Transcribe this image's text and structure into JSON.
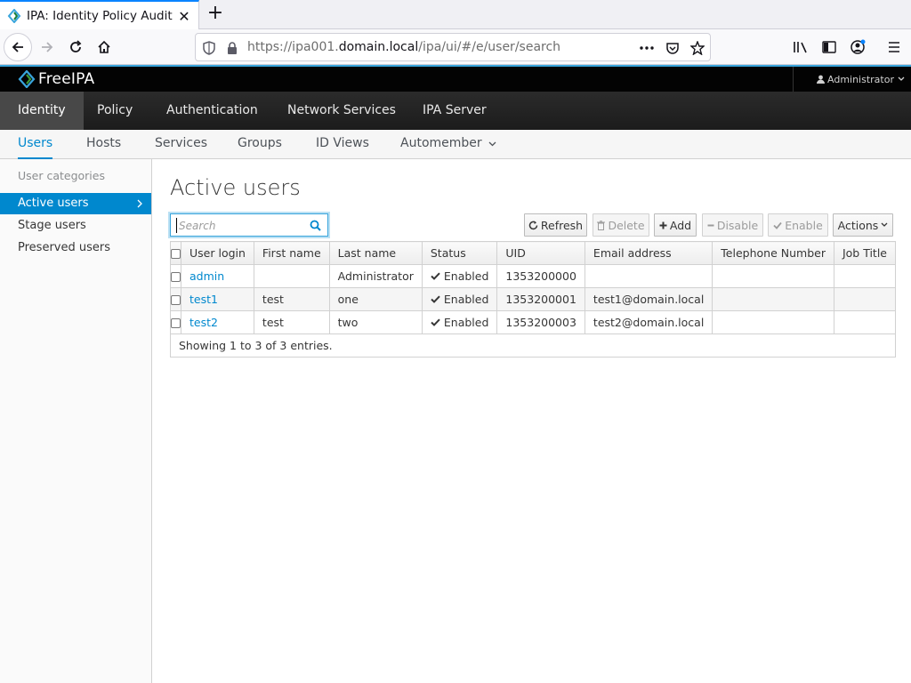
{
  "browser": {
    "tab_title": "IPA: Identity Policy Audit",
    "tab_close": "✕",
    "new_tab": "+",
    "url_prefix": "https://ipa001.",
    "url_host": "domain.local",
    "url_path": "/ipa/ui/#/e/user/search"
  },
  "header": {
    "brand": "FreeIPA",
    "user_menu": "Administrator"
  },
  "primary_nav": [
    {
      "label": "Identity",
      "active": true
    },
    {
      "label": "Policy"
    },
    {
      "label": "Authentication"
    },
    {
      "label": "Network Services"
    },
    {
      "label": "IPA Server"
    }
  ],
  "secondary_nav": [
    {
      "label": "Users",
      "active": true
    },
    {
      "label": "Hosts"
    },
    {
      "label": "Services"
    },
    {
      "label": "Groups"
    },
    {
      "label": "ID Views"
    },
    {
      "label": "Automember"
    }
  ],
  "sidebar": {
    "heading": "User categories",
    "items": [
      {
        "label": "Active users",
        "active": true
      },
      {
        "label": "Stage users"
      },
      {
        "label": "Preserved users"
      }
    ]
  },
  "main": {
    "title": "Active users",
    "search_placeholder": "Search",
    "toolbar": {
      "refresh": "Refresh",
      "delete": "Delete",
      "add": "Add",
      "disable": "Disable",
      "enable": "Enable",
      "actions": "Actions"
    },
    "columns": [
      "User login",
      "First name",
      "Last name",
      "Status",
      "UID",
      "Email address",
      "Telephone Number",
      "Job Title"
    ],
    "rows": [
      {
        "login": "admin",
        "first": "",
        "last": "Administrator",
        "status": "Enabled",
        "uid": "1353200000",
        "email": "",
        "phone": "",
        "job": ""
      },
      {
        "login": "test1",
        "first": "test",
        "last": "one",
        "status": "Enabled",
        "uid": "1353200001",
        "email": "test1@domain.local",
        "phone": "",
        "job": ""
      },
      {
        "login": "test2",
        "first": "test",
        "last": "two",
        "status": "Enabled",
        "uid": "1353200003",
        "email": "test2@domain.local",
        "phone": "",
        "job": ""
      }
    ],
    "footer": "Showing 1 to 3 of 3 entries."
  },
  "colors": {
    "accent": "#0088ce",
    "brand_stripe": "#39a5dc",
    "header_bg": "#030303",
    "nav_bg": "#1c1c1c"
  }
}
